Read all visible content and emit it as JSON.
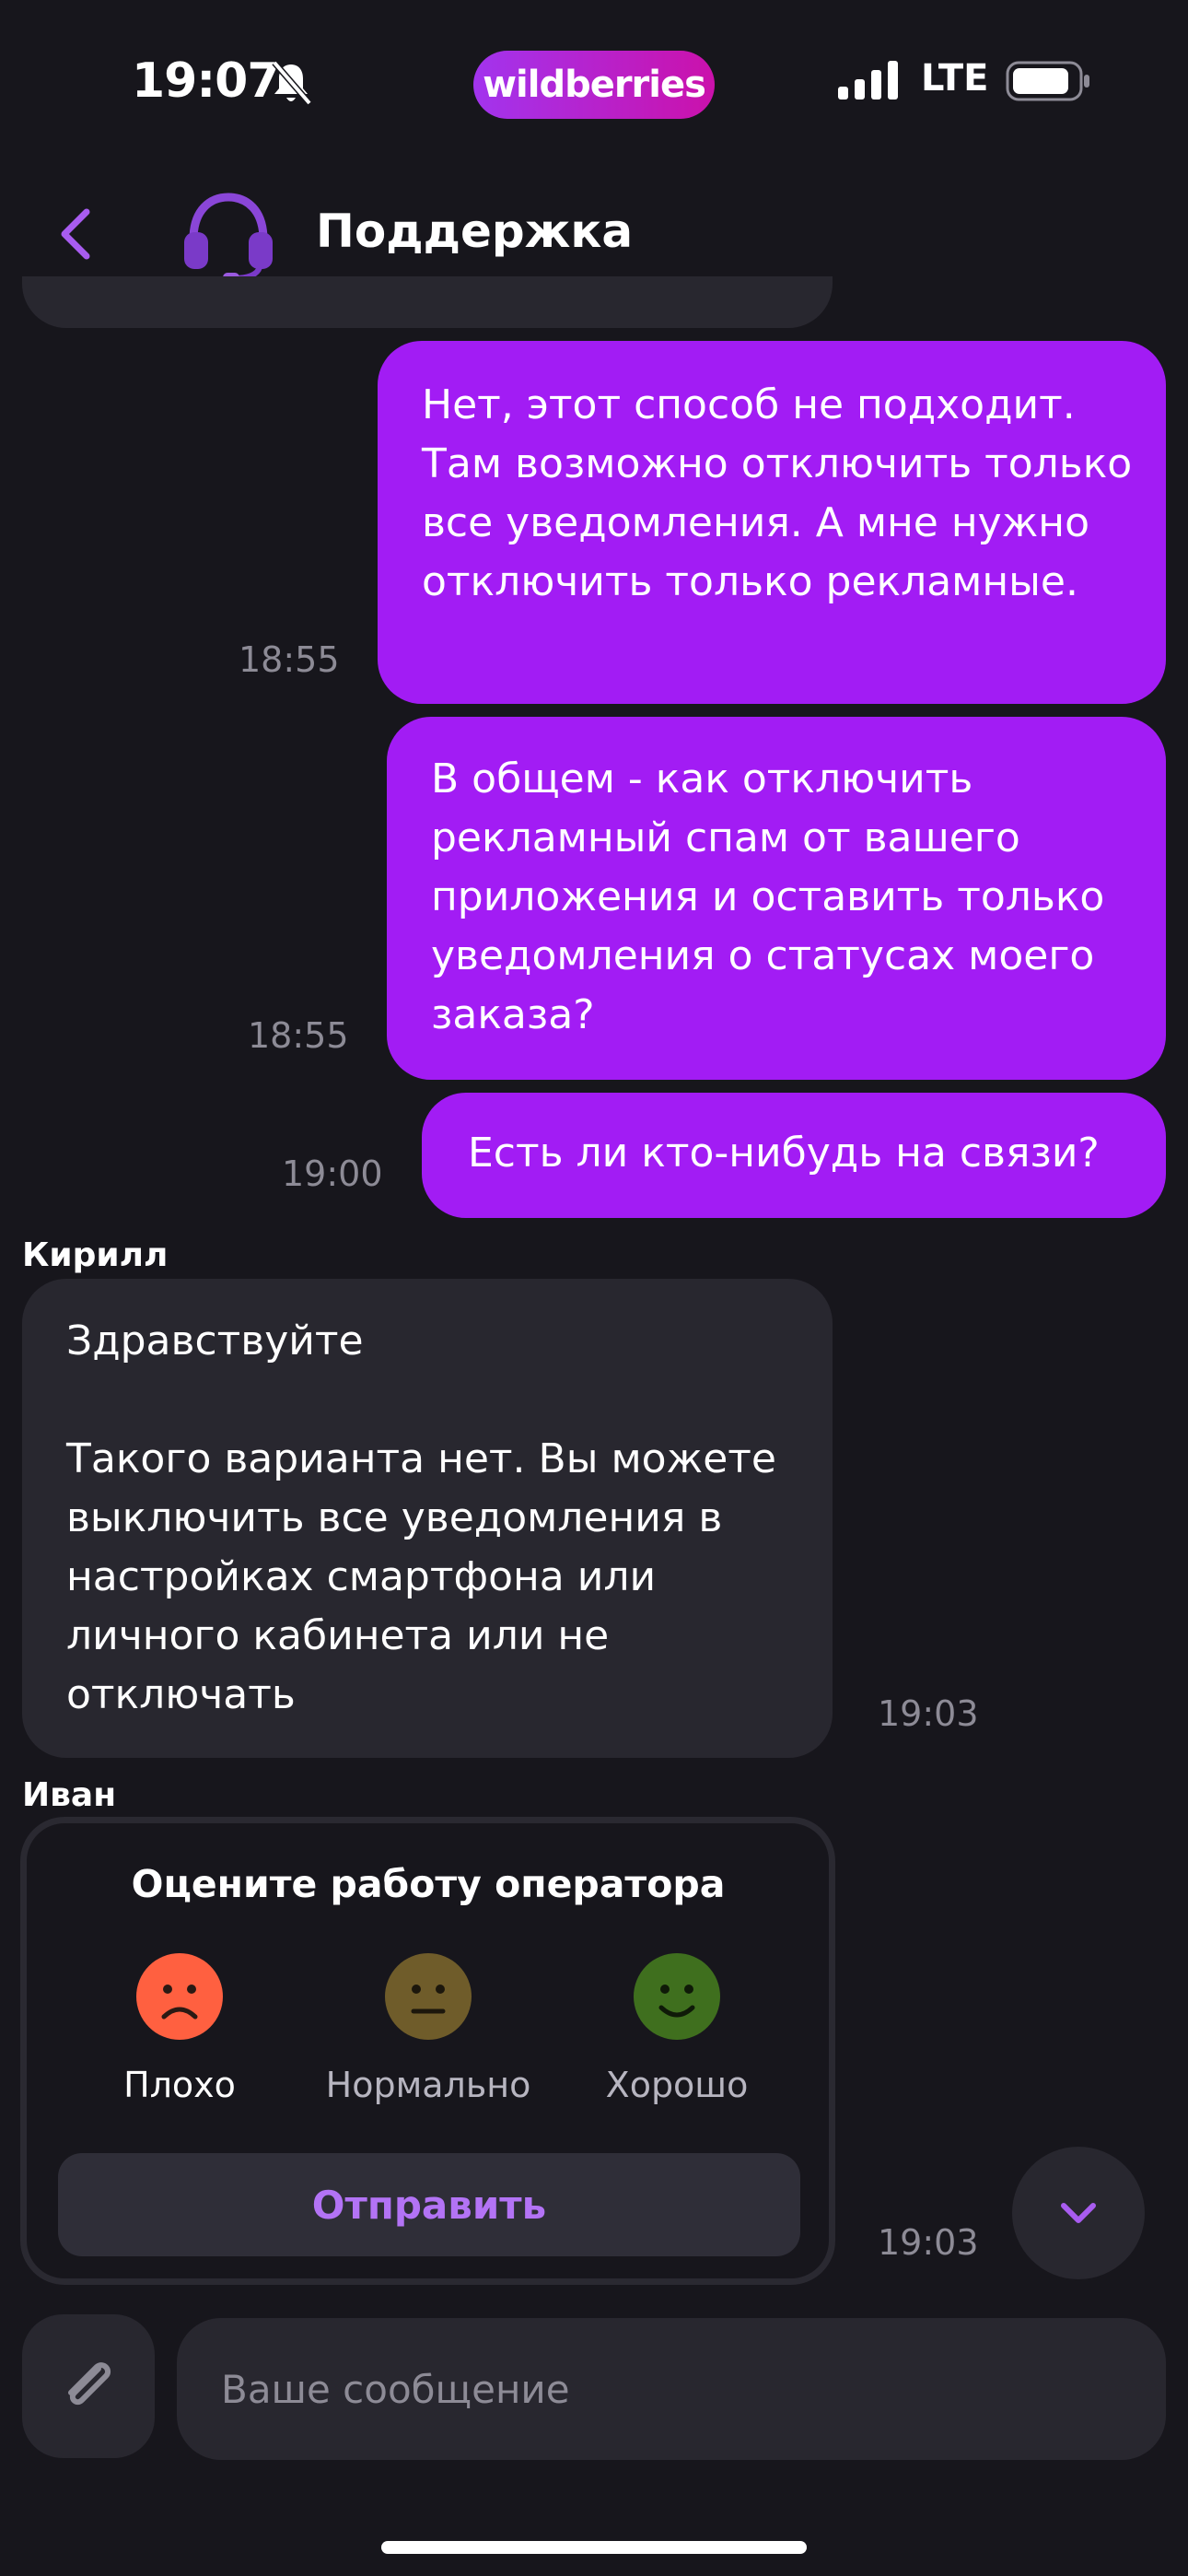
{
  "status_bar": {
    "time": "19:07",
    "brand": "wildberries",
    "network": "LTE"
  },
  "header": {
    "title": "Поддержка"
  },
  "messages": [
    {
      "direction": "out",
      "text": "Нет, этот способ не подходит. Там возможно отключить только все уведомления. А мне нужно отключить только рекламные.",
      "time": "18:55"
    },
    {
      "direction": "out",
      "text": "В общем - как отключить рекламный спам от вашего приложения и оставить только уведомления о статусах моего заказа?",
      "time": "18:55"
    },
    {
      "direction": "out",
      "text": "Есть ли кто-нибудь на связи?",
      "time": "19:00"
    },
    {
      "direction": "in",
      "sender": "Кирилл",
      "text": "Здравствуйте\n\nТакого варианта нет. Вы можете выключить все уведомления в настройках смартфона или личного кабинета или не отключать",
      "time": "19:03"
    }
  ],
  "rating": {
    "sender": "Иван",
    "title": "Оцените работу оператора",
    "options": [
      {
        "label": "Плохо",
        "icon": "sad-face-icon",
        "color": "#ff6040"
      },
      {
        "label": "Нормально",
        "icon": "neutral-face-icon",
        "color": "#6f5c2a"
      },
      {
        "label": "Хорошо",
        "icon": "happy-face-icon",
        "color": "#3f6f1e"
      }
    ],
    "submit_label": "Отправить",
    "time": "19:03"
  },
  "composer": {
    "placeholder": "Ваше сообщение"
  },
  "colors": {
    "background": "#17161c",
    "outgoing_bubble": "#a21cf4",
    "incoming_bubble": "#28272f",
    "accent": "#b373f5"
  }
}
